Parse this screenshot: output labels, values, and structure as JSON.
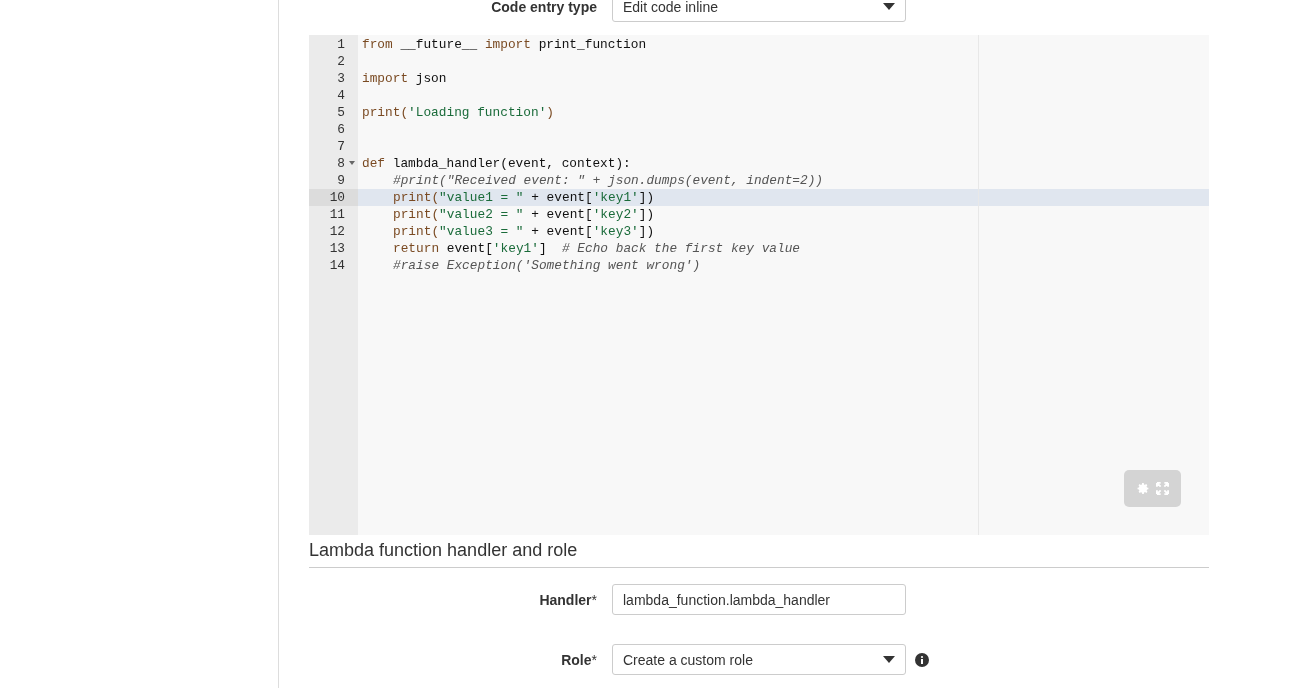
{
  "code_entry": {
    "label": "Code entry type",
    "value": "Edit code inline"
  },
  "editor": {
    "lines": [
      {
        "number": "1",
        "selected": false,
        "foldable": false,
        "tokens": [
          {
            "text": "from",
            "kind": "keyword"
          },
          {
            "text": " __future__ ",
            "kind": "plain"
          },
          {
            "text": "import",
            "kind": "keyword"
          },
          {
            "text": " print_function",
            "kind": "plain"
          }
        ]
      },
      {
        "number": "2",
        "selected": false,
        "foldable": false
      },
      {
        "number": "3",
        "selected": false,
        "foldable": false,
        "tokens": [
          {
            "text": "import",
            "kind": "keyword"
          },
          {
            "text": " json",
            "kind": "plain"
          }
        ]
      },
      {
        "number": "4",
        "selected": false,
        "foldable": false
      },
      {
        "number": "5",
        "selected": false,
        "foldable": false,
        "tokens": [
          {
            "text": "print(",
            "kind": "keyword"
          },
          {
            "text": "'Loading function'",
            "kind": "string"
          },
          {
            "text": ")",
            "kind": "keyword"
          }
        ]
      },
      {
        "number": "6",
        "selected": false,
        "foldable": false
      },
      {
        "number": "7",
        "selected": false,
        "foldable": false
      },
      {
        "number": "8",
        "selected": false,
        "foldable": true,
        "tokens": [
          {
            "text": "def",
            "kind": "keyword"
          },
          {
            "text": " lambda_handler(event, context):",
            "kind": "plain"
          }
        ]
      },
      {
        "number": "9",
        "selected": false,
        "foldable": false,
        "indented": true,
        "tokens": [
          {
            "text": "#print(\"Received event: \" + json.dumps(event, indent=2))",
            "kind": "comment"
          }
        ]
      },
      {
        "number": "10",
        "selected": true,
        "foldable": false,
        "indented": true,
        "tokens": [
          {
            "text": "print(",
            "kind": "keyword"
          },
          {
            "text": "\"value1 = \"",
            "kind": "string"
          },
          {
            "text": " + event[",
            "kind": "plain"
          },
          {
            "text": "'key1'",
            "kind": "string"
          },
          {
            "text": "])",
            "kind": "plain"
          }
        ]
      },
      {
        "number": "11",
        "selected": false,
        "foldable": false,
        "indented": true,
        "tokens": [
          {
            "text": "print(",
            "kind": "keyword"
          },
          {
            "text": "\"value2 = \"",
            "kind": "string"
          },
          {
            "text": " + event[",
            "kind": "plain"
          },
          {
            "text": "'key2'",
            "kind": "string"
          },
          {
            "text": "])",
            "kind": "plain"
          }
        ]
      },
      {
        "number": "12",
        "selected": false,
        "foldable": false,
        "indented": true,
        "tokens": [
          {
            "text": "print(",
            "kind": "keyword"
          },
          {
            "text": "\"value3 = \"",
            "kind": "string"
          },
          {
            "text": " + event[",
            "kind": "plain"
          },
          {
            "text": "'key3'",
            "kind": "string"
          },
          {
            "text": "])",
            "kind": "plain"
          }
        ]
      },
      {
        "number": "13",
        "selected": false,
        "foldable": false,
        "indented": true,
        "tokens": [
          {
            "text": "return",
            "kind": "keyword"
          },
          {
            "text": " event[",
            "kind": "plain"
          },
          {
            "text": "'key1'",
            "kind": "string"
          },
          {
            "text": "]  ",
            "kind": "plain"
          },
          {
            "text": "# Echo back the first key value",
            "kind": "comment"
          }
        ]
      },
      {
        "number": "14",
        "selected": false,
        "foldable": false,
        "indented": true,
        "tokens": [
          {
            "text": "#raise Exception('Something went wrong')",
            "kind": "comment"
          }
        ]
      }
    ]
  },
  "section": {
    "title": "Lambda function handler and role"
  },
  "fields": [
    {
      "kind": "input",
      "label": "Handler",
      "marker": "*",
      "value": "lambda_function.lambda_handler",
      "info": false
    },
    {
      "kind": "select",
      "label": "Role",
      "marker": "*",
      "value": "Create a custom role",
      "info": true
    }
  ]
}
